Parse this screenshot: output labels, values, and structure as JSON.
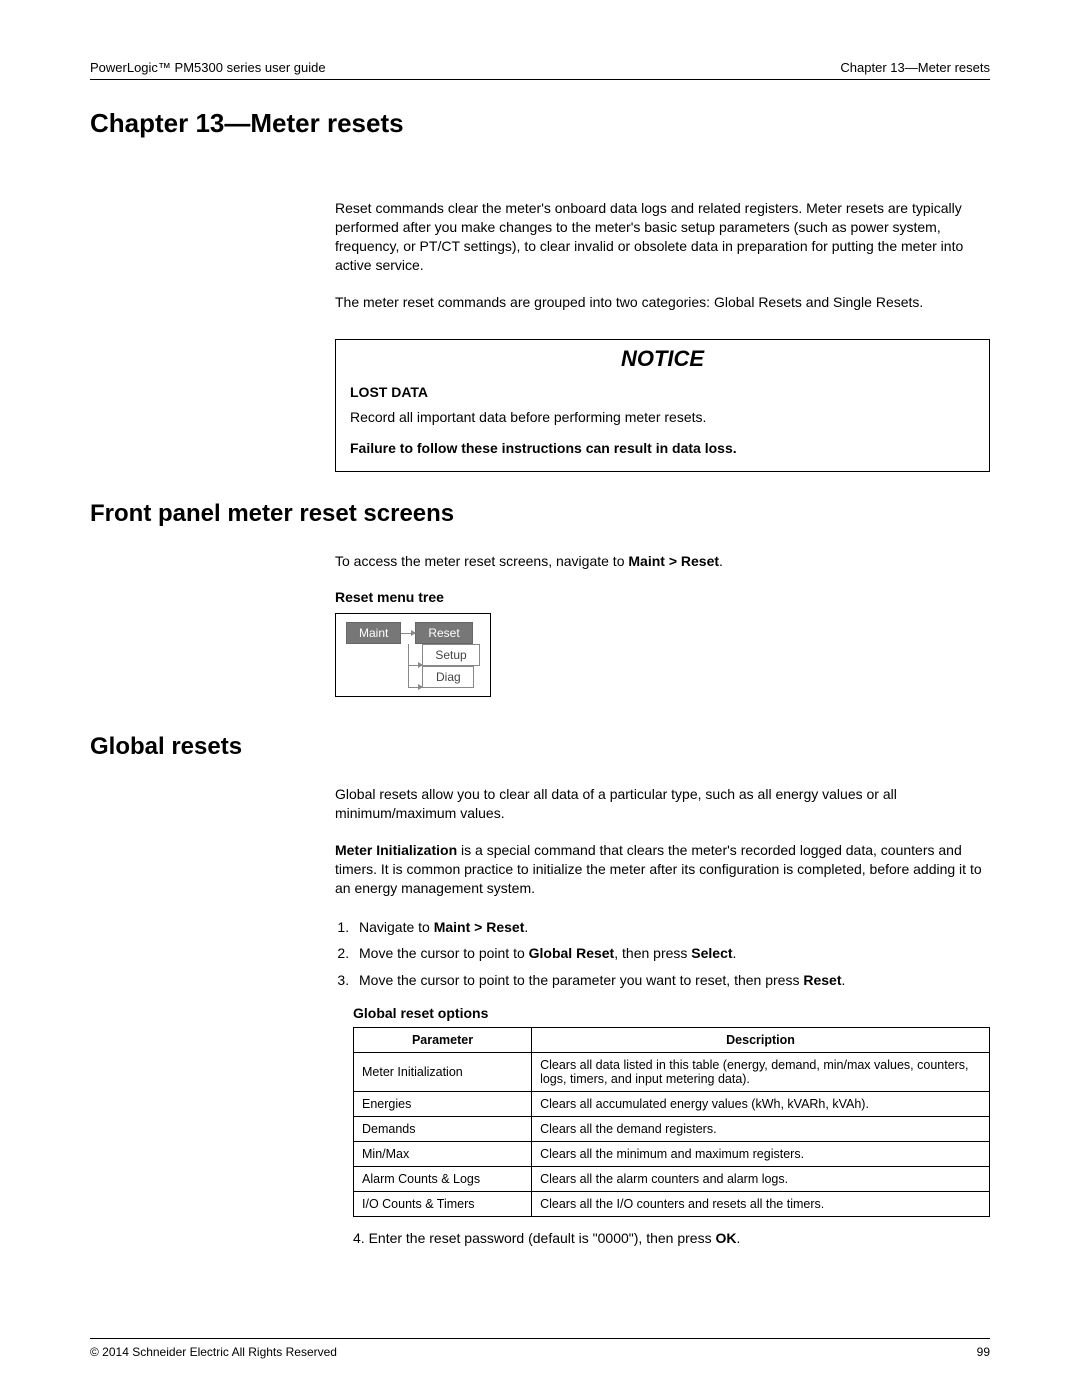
{
  "header": {
    "left": "PowerLogic™  PM5300 series user guide",
    "right": "Chapter 13—Meter resets"
  },
  "chapter_title": "Chapter 13—Meter resets",
  "intro": {
    "p1": "Reset commands clear the meter's onboard data logs and related registers. Meter resets are typically performed after you make changes to the meter's basic setup parameters (such as power system, frequency, or PT/CT settings), to clear invalid or obsolete data in preparation for putting the meter into active service.",
    "p2": "The meter reset commands are grouped into two categories: Global Resets and Single Resets."
  },
  "notice": {
    "title": "NOTICE",
    "subhead": "LOST DATA",
    "text": "Record all important data before performing meter resets.",
    "warn": "Failure to follow these instructions can result in data loss."
  },
  "front_panel": {
    "title": "Front panel meter reset screens",
    "intro_prefix": "To access the meter reset screens, navigate to ",
    "intro_bold": "Maint > Reset",
    "intro_suffix": ".",
    "figure_caption": "Reset menu tree",
    "menu": {
      "maint": "Maint",
      "reset": "Reset",
      "setup": "Setup",
      "diag": "Diag"
    }
  },
  "global_resets": {
    "title": "Global resets",
    "p1": "Global resets allow you to clear all data of a particular type, such as all energy values or all minimum/maximum values.",
    "p2_bold": "Meter Initialization",
    "p2_rest": " is a special command that clears the meter's recorded logged data, counters and timers. It is common practice to initialize the meter after its configuration is completed, before adding it to an energy management system.",
    "steps": {
      "s1_prefix": "Navigate to ",
      "s1_bold": "Maint > Reset",
      "s1_suffix": ".",
      "s2_prefix": "Move the cursor to point to ",
      "s2_bold1": "Global Reset",
      "s2_mid": ", then press ",
      "s2_bold2": "Select",
      "s2_suffix": ".",
      "s3_prefix": "Move the cursor to point to the parameter you want to reset, then press ",
      "s3_bold": "Reset",
      "s3_suffix": "."
    },
    "table_caption": "Global reset options",
    "table": {
      "headers": {
        "param": "Parameter",
        "desc": "Description"
      },
      "rows": [
        {
          "param": "Meter Initialization",
          "desc": "Clears all data listed in this table (energy, demand, min/max values, counters, logs, timers, and input metering data)."
        },
        {
          "param": "Energies",
          "desc": "Clears all accumulated energy values (kWh, kVARh, kVAh)."
        },
        {
          "param": "Demands",
          "desc": "Clears all the demand registers."
        },
        {
          "param": "Min/Max",
          "desc": "Clears all the minimum and maximum registers."
        },
        {
          "param": "Alarm Counts & Logs",
          "desc": "Clears all the alarm counters and alarm logs."
        },
        {
          "param": "I/O Counts & Timers",
          "desc": "Clears all the I/O counters and resets all the timers."
        }
      ]
    },
    "step4_prefix": "4.   Enter the reset password (default is \"0000\"), then press ",
    "step4_bold": "OK",
    "step4_suffix": "."
  },
  "footer": {
    "left": "© 2014 Schneider Electric All Rights Reserved",
    "right": "99"
  }
}
